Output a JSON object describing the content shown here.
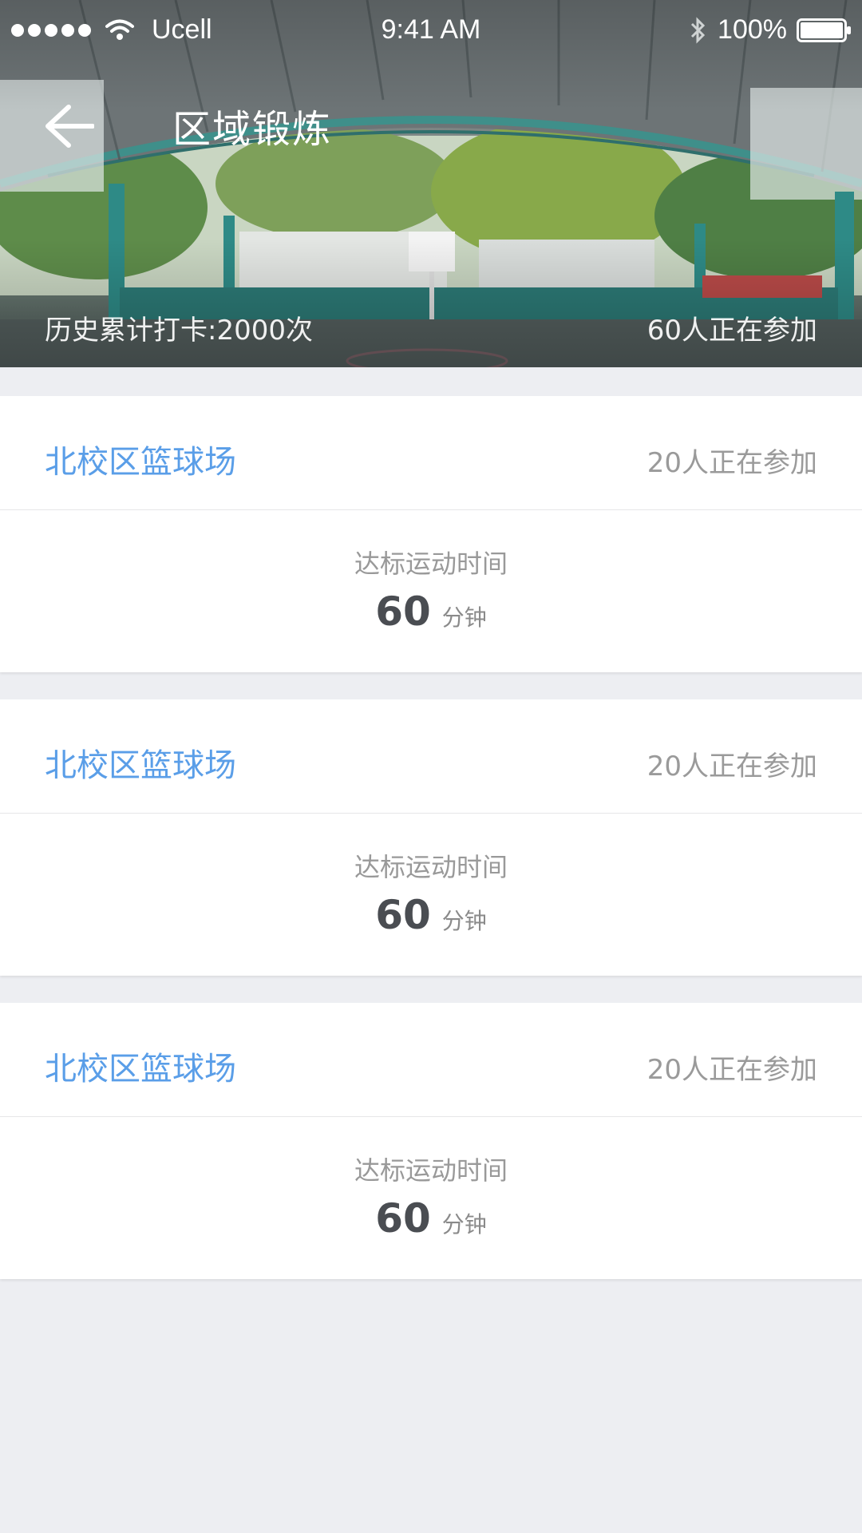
{
  "status_bar": {
    "carrier": "Ucell",
    "time": "9:41 AM",
    "battery": "100%"
  },
  "header": {
    "title": "区域锻炼",
    "history": "历史累计打卡:2000次",
    "participants": "60人正在参加"
  },
  "courts": [
    {
      "name": "北校区篮球场",
      "participants": "20人正在参加",
      "label": "达标运动时间",
      "value": "60",
      "unit": "分钟"
    },
    {
      "name": "北校区篮球场",
      "participants": "20人正在参加",
      "label": "达标运动时间",
      "value": "60",
      "unit": "分钟"
    },
    {
      "name": "北校区篮球场",
      "participants": "20人正在参加",
      "label": "达标运动时间",
      "value": "60",
      "unit": "分钟"
    }
  ],
  "colors": {
    "accent": "#5a9ee8",
    "background": "#edeef2",
    "value_text": "#4a4d52",
    "muted_text": "#9a9a9a"
  }
}
